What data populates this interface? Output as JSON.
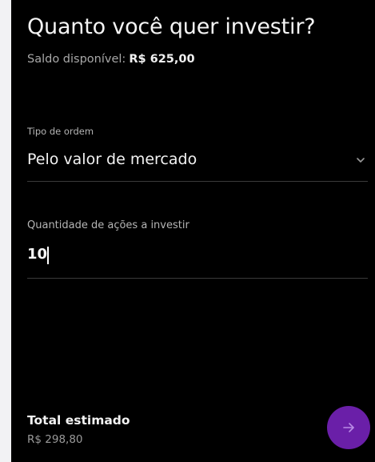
{
  "header": {
    "title": "Quanto você quer investir?",
    "balance_label": "Saldo disponível:",
    "balance_value": "R$ 625,00"
  },
  "order_type": {
    "label": "Tipo de ordem",
    "selected": "Pelo valor de mercado",
    "icon": "chevron-down-icon"
  },
  "quantity": {
    "label": "Quantidade de ações a investir",
    "value": "10"
  },
  "footer": {
    "total_label": "Total estimado",
    "total_value": "R$ 298,80",
    "next_icon": "arrow-right-icon"
  },
  "colors": {
    "background": "#000000",
    "accent": "#6a1fa8",
    "accent_icon": "#b98ce6",
    "muted_text": "#a8a8a8",
    "divider": "#3a3a3a"
  }
}
